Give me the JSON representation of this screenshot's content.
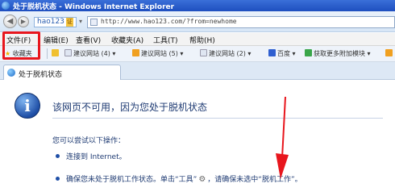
{
  "window": {
    "title": "处于脱机状态 - Windows Internet Explorer"
  },
  "addressbar": {
    "back_glyph": "◀",
    "forward_glyph": "▶",
    "hao_label": "hao123",
    "hao_badge": "证",
    "url": "http://www.hao123.com/?from=newhome"
  },
  "menubar": {
    "items": [
      "文件(F)",
      "编辑(E)",
      "查看(V)",
      "收藏夹(A)",
      "工具(T)",
      "帮助(H)"
    ]
  },
  "favorites": {
    "label": "收藏夹",
    "items": [
      {
        "label": "建议网站 (4) ▾",
        "color": "#f0a020"
      },
      {
        "label": "建议网站 (5) ▾",
        "color": "#f0a020"
      },
      {
        "label": "建议网站 (2) ▾",
        "color": "#5a8fd6"
      },
      {
        "label": "百度 ▾",
        "color": "#2f5fd0"
      },
      {
        "label": "获取更多附加模块 ▾",
        "color": "#3aa64a"
      }
    ]
  },
  "tab": {
    "label": "处于脱机状态"
  },
  "content": {
    "headline": "该网页不可用，因为您处于脱机状态",
    "subtitle": "您可以尝试以下操作：",
    "bullet1": "连接到 Internet。",
    "bullet2_part1": "确保您未处于脱机工作状态。单击“工具”",
    "bullet2_part2": "，请确保未选中“脱机工作”。"
  },
  "colors": {
    "highlight": "#e8161d",
    "title_bar": "#1e4fbf",
    "text_blue": "#1f3b73"
  }
}
